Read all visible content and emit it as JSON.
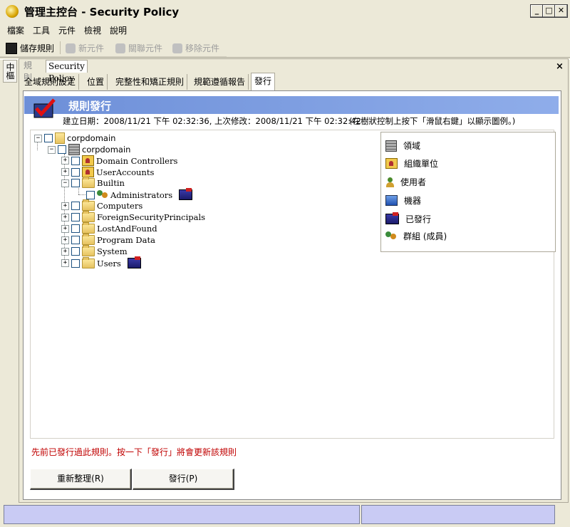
{
  "window": {
    "title_main": "管理主控台",
    "title_sub": " - Security Policy",
    "btn_min": "_",
    "btn_max": "□",
    "btn_close": "✕"
  },
  "menu": [
    "檔案",
    "工具",
    "元件",
    "檢視",
    "說明"
  ],
  "toolbar": {
    "save": "儲存規則",
    "new": "新元件",
    "link": "關聯元件",
    "remove": "移除元件"
  },
  "side_tab": "中樞",
  "doc_tabs": {
    "rules": "規則",
    "current": "Security Policy",
    "close": "×"
  },
  "sub_tabs": [
    "全域規則設定",
    "位置",
    "完整性和矯正規則",
    "規範遵循報告",
    "發行"
  ],
  "banner": {
    "title": "規則發行"
  },
  "info": {
    "line": "建立日期：2008/11/21 下午 02:32:36, 上次修改：2008/11/21 下午 02:32:42",
    "hint": "(在樹狀控制上按下「滑鼠右鍵」以顯示圖例。)"
  },
  "tree": {
    "root": "corpdomain",
    "domain": "corpdomain",
    "items": [
      "Domain Controllers",
      "UserAccounts",
      "Builtin",
      "Administrators",
      "Computers",
      "ForeignSecurityPrincipals",
      "LostAndFound",
      "Program Data",
      "System",
      "Users"
    ]
  },
  "legend": [
    "領域",
    "組織單位",
    "使用者",
    "機器",
    "已發行",
    "群組 (成員)"
  ],
  "status_message": "先前已發行過此規則。按一下「發行」將會更新該規則",
  "buttons": {
    "refresh": "重新整理(R)",
    "publish": "發行(P)"
  }
}
